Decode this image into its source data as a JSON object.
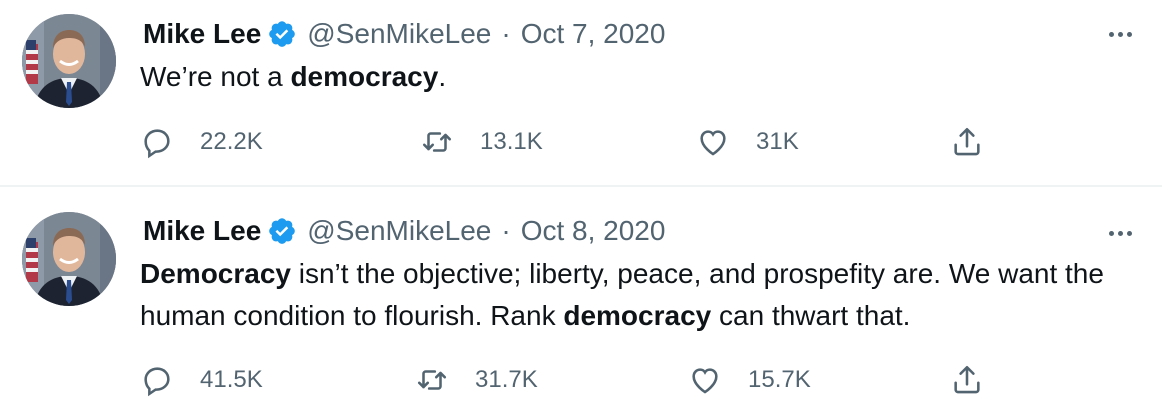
{
  "tweets": [
    {
      "author": {
        "name": "Mike Lee",
        "handle": "@SenMikeLee",
        "verified": true,
        "avatar": "portrait-photo"
      },
      "separator": "·",
      "date": "Oct 7, 2020",
      "text_parts": [
        "We’re not a ",
        "democracy",
        "."
      ],
      "stats": {
        "replies": "22.2K",
        "retweets": "13.1K",
        "likes": "31K"
      }
    },
    {
      "author": {
        "name": "Mike Lee",
        "handle": "@SenMikeLee",
        "verified": true,
        "avatar": "portrait-photo"
      },
      "separator": "·",
      "date": "Oct 8, 2020",
      "text_parts": [
        "Democracy",
        " isn’t the objective; liberty, peace, and prospefity are.  We want the human condition to flourish.  Rank ",
        "democracy",
        " can thwart that."
      ],
      "stats": {
        "replies": "41.5K",
        "retweets": "31.7K",
        "likes": "15.7K"
      }
    }
  ],
  "icons": {
    "verified": "verified-badge-icon",
    "more": "more-options-icon",
    "reply": "reply-icon",
    "retweet": "retweet-icon",
    "like": "heart-icon",
    "share": "share-icon"
  },
  "colors": {
    "text": "#0f1419",
    "muted": "#536471",
    "verified_blue": "#1d9bf0",
    "divider": "#eff3f4",
    "background": "#ffffff"
  }
}
